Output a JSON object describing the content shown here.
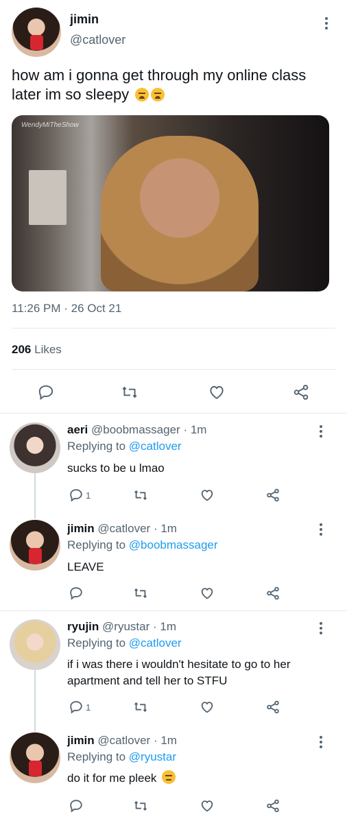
{
  "main_tweet": {
    "name": "jimin",
    "handle": "@catlover",
    "text": "how am i gonna get through my online class later im so sleepy",
    "media_watermark": "WendyMiTheShow",
    "timestamp": "11:26 PM · 26 Oct 21",
    "likes_count": "206",
    "likes_label": "Likes"
  },
  "replies": [
    {
      "name": "aeri",
      "handle": "@boobmassager",
      "time": "· 1m",
      "replying_label": "Replying to",
      "replying_to": "@catlover",
      "text": "sucks to be u lmao",
      "reply_count": "1"
    },
    {
      "name": "jimin",
      "handle": "@catlover",
      "time": "· 1m",
      "replying_label": "Replying to",
      "replying_to": "@boobmassager",
      "text": "LEAVE",
      "reply_count": ""
    },
    {
      "name": "ryujin",
      "handle": "@ryustar",
      "time": "· 1m",
      "replying_label": "Replying to",
      "replying_to": "@catlover",
      "text": "if i was there i wouldn't hesitate to go to her apartment and tell her to STFU",
      "reply_count": "1"
    },
    {
      "name": "jimin",
      "handle": "@catlover",
      "time": "· 1m",
      "replying_label": "Replying to",
      "replying_to": "@ryustar",
      "text": "do it for me pleek",
      "reply_count": ""
    }
  ],
  "colors": {
    "link": "#1d9bf0",
    "secondary": "#536471",
    "text": "#0f1419",
    "divider": "#e5e8eb"
  },
  "icons": [
    "reply-icon",
    "retweet-icon",
    "like-icon",
    "share-icon",
    "more-icon",
    "tired-face-emoji",
    "pleading-face-emoji"
  ]
}
